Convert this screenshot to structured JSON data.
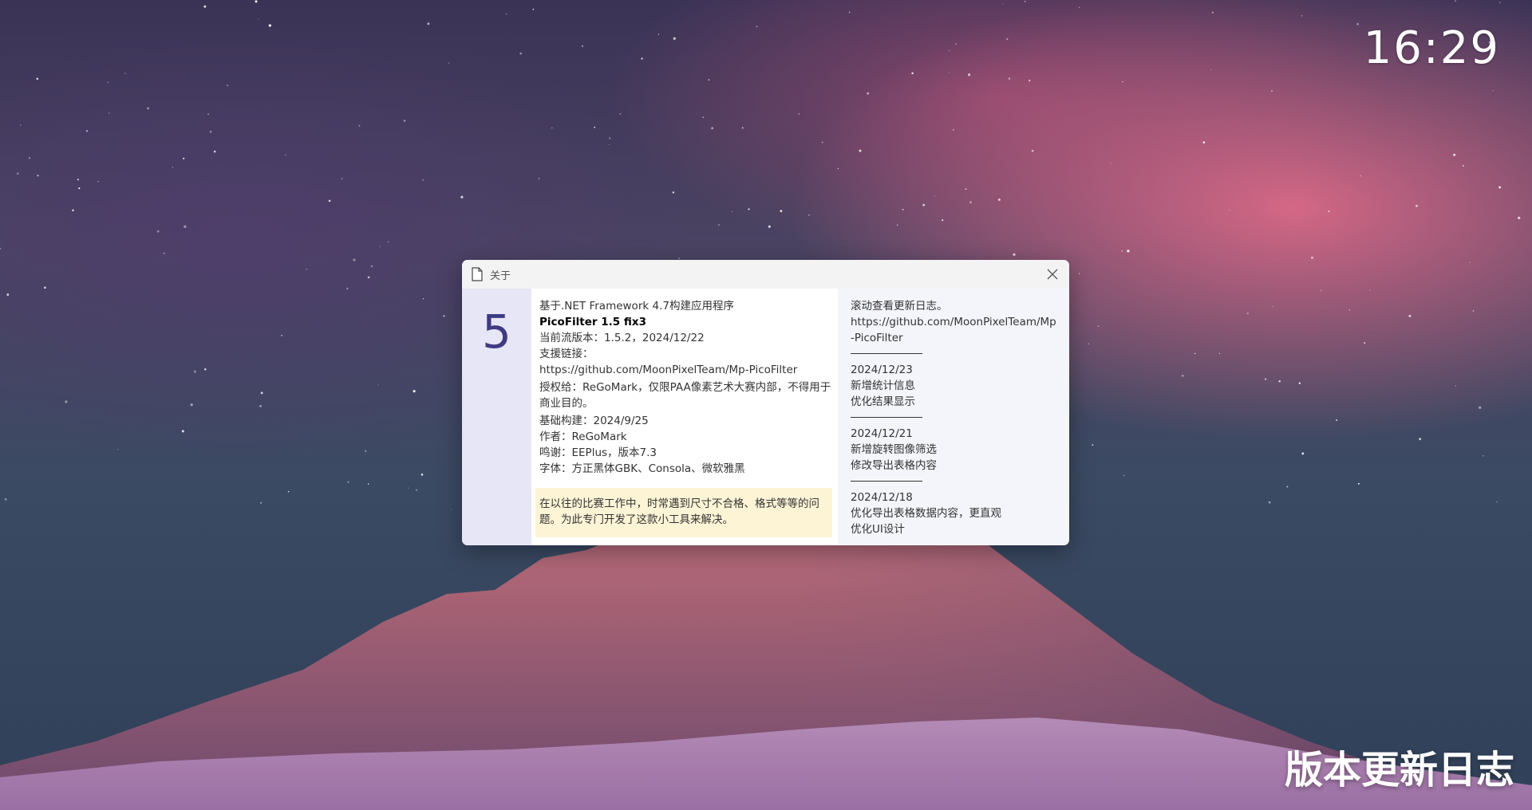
{
  "desktop": {
    "clock": "16:29",
    "caption": "版本更新日志"
  },
  "dialog": {
    "title": "关于",
    "title_icon": "document-icon",
    "close_icon": "close-icon",
    "version_number": "5",
    "info": {
      "line1": "基于.NET Framework 4.7构建应用程序",
      "product": "PicoFilter 1.5 fix3",
      "current_version": "当前流版本：1.5.2，2024/12/22",
      "support_label": "支援链接：",
      "support_url": "https://github.com/MoonPixelTeam/Mp-PicoFilter",
      "license": "授权给：ReGoMark，仅限PAA像素艺术大赛内部，不得用于商业目的。",
      "base_build": "基础构建：2024/9/25",
      "author": "作者：ReGoMark",
      "thanks": "鸣谢：EEPlus，版本7.3",
      "fonts": "字体：方正黑体GBK、Consola、微软雅黑"
    },
    "note": "在以往的比赛工作中，时常遇到尺寸不合格、格式等等的问题。为此专门开发了这款小工具来解决。",
    "changelog": {
      "header": "滚动查看更新日志。",
      "url": "https://github.com/MoonPixelTeam/Mp-PicoFilter",
      "entries": [
        {
          "date": "2024/12/23",
          "lines": [
            "新增统计信息",
            "优化结果显示"
          ]
        },
        {
          "date": "2024/12/21",
          "lines": [
            "新增旋转图像筛选",
            "修改导出表格内容"
          ]
        },
        {
          "date": "2024/12/18",
          "lines": [
            "优化导出表格数据内容，更直观",
            "优化UI设计"
          ]
        }
      ]
    }
  },
  "colors": {
    "accent": "#3f3b82",
    "left_pane": "#e6e6f6",
    "note_bg": "#fdf4d6",
    "changelog_bg": "#f4f5fa"
  }
}
